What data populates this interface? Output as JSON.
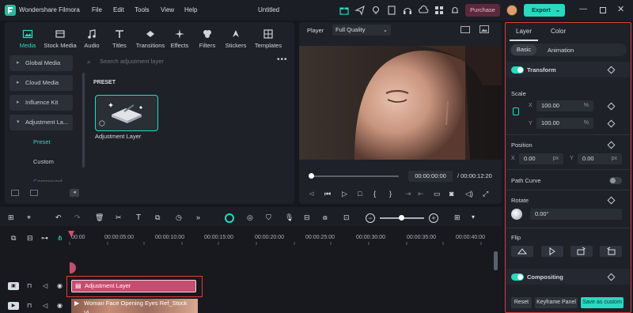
{
  "app": {
    "name": "Wondershare Filmora",
    "title": "Untitled",
    "menu": [
      "File",
      "Edit",
      "Tools",
      "View",
      "Help"
    ],
    "purchase_label": "Purchase",
    "export_label": "Export"
  },
  "media": {
    "tabs": [
      {
        "label": "Media",
        "icon": "media-icon",
        "active": true
      },
      {
        "label": "Stock Media",
        "icon": "stock-media-icon"
      },
      {
        "label": "Audio",
        "icon": "music-icon"
      },
      {
        "label": "Titles",
        "icon": "titles-icon"
      },
      {
        "label": "Transitions",
        "icon": "transitions-icon"
      },
      {
        "label": "Effects",
        "icon": "effects-icon"
      },
      {
        "label": "Filters",
        "icon": "filters-icon"
      },
      {
        "label": "Stickers",
        "icon": "stickers-icon"
      },
      {
        "label": "Templates",
        "icon": "templates-icon"
      }
    ],
    "library": [
      "Global Media",
      "Cloud Media",
      "Influence Kit",
      "Adjustment La..."
    ],
    "library_sub": [
      "Preset",
      "Custom",
      "Compound Clip"
    ],
    "search_placeholder": "Search adjustment layer",
    "section_label": "PRESET",
    "card_label": "Adjustment Layer"
  },
  "player": {
    "label": "Player",
    "quality": "Full Quality",
    "current_time": "00:00:00:00",
    "total_time": "/ 00:00:12:20",
    "progress": 0.0
  },
  "properties": {
    "tabs": [
      "Layer",
      "Color"
    ],
    "subtabs": [
      "Basic",
      "Animation"
    ],
    "transform_label": "Transform",
    "scale_label": "Scale",
    "scale_x": "100.00",
    "scale_y": "100.00",
    "percent": "%",
    "x_label": "X",
    "y_label": "Y",
    "position_label": "Position",
    "pos_x": "0.00",
    "pos_y": "0.00",
    "px": "px",
    "path_curve_label": "Path Curve",
    "rotate_label": "Rotate",
    "rotate_value": "0.00°",
    "flip_label": "Flip",
    "compositing_label": "Compositing",
    "reset_label": "Reset",
    "keyframe_label": "Keyframe Panel",
    "save_custom_label": "Save as custom",
    "accent": "#29d9c0"
  },
  "timeline": {
    "ticks": [
      "00:00",
      "00:00:05:00",
      "00:00:10:00",
      "00:00:15:00",
      "00:00:20:00",
      "00:00:25:00",
      "00:00:30:00",
      "00:00:35:00",
      "00:00:40:00"
    ],
    "adjustment_clip": "Adjustment Layer",
    "video_clip": "Woman Face Opening Eyes Ref_Stock Vi..."
  }
}
